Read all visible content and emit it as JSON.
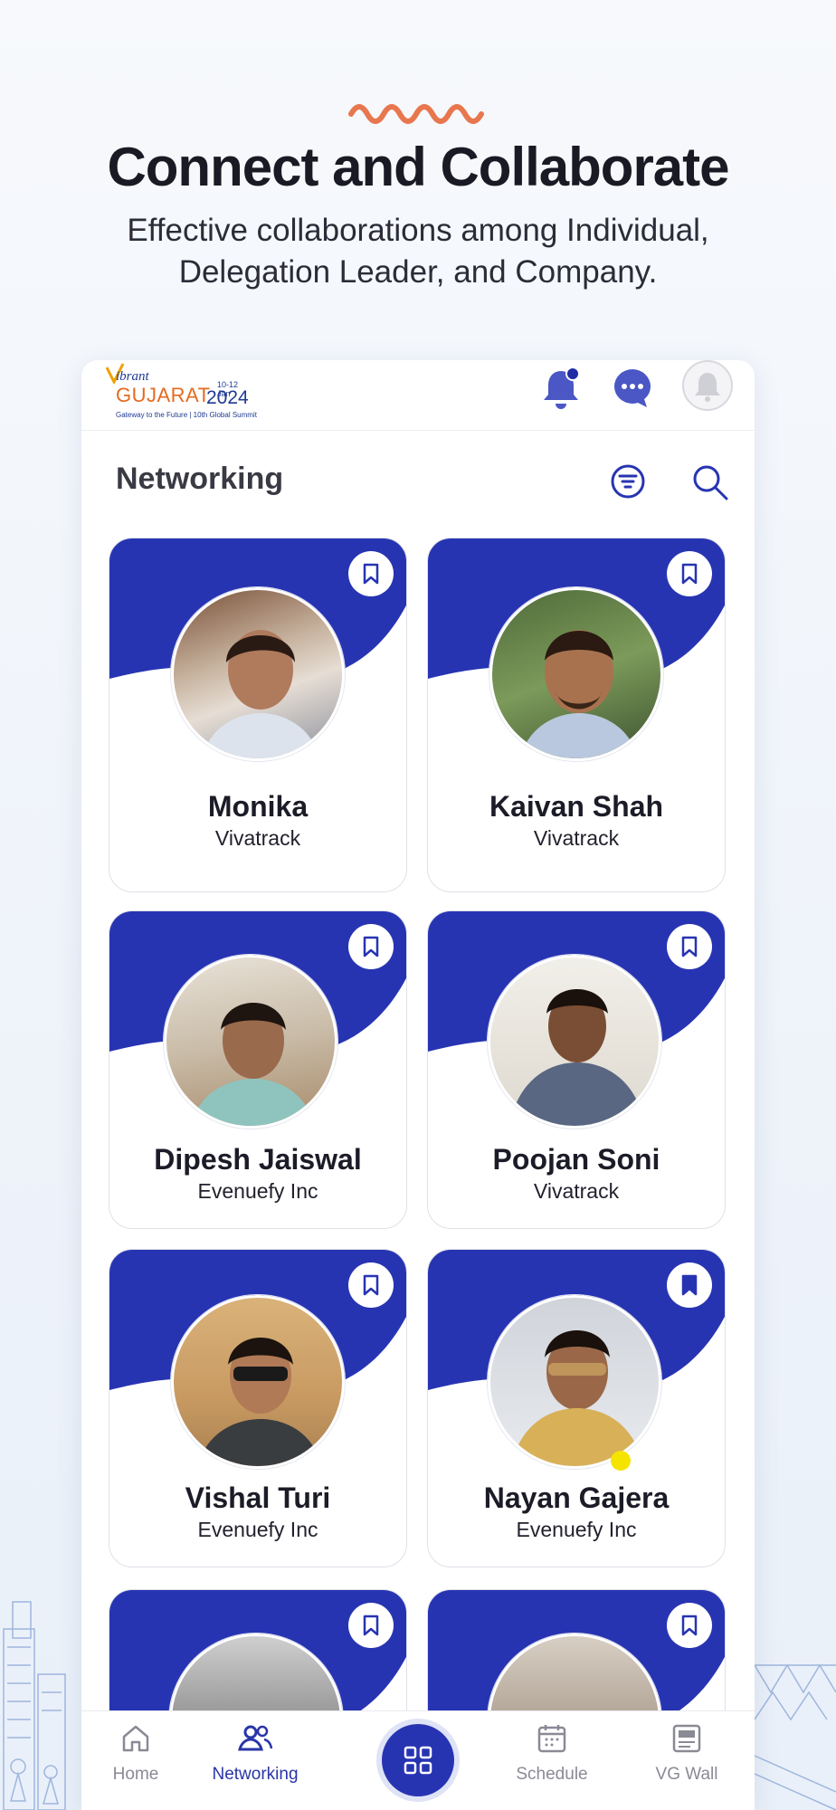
{
  "hero": {
    "title": "Connect and Collaborate",
    "subtitle": "Effective collaborations among Individual, Delegation Leader, and Company."
  },
  "app": {
    "logo": {
      "brand_top": "ibrant",
      "brand_main": "GUJARAT",
      "dates": "10-12 Jan",
      "year": "2024",
      "tagline": "Gateway to the Future | 10th Global Summit"
    },
    "page_title": "Networking"
  },
  "colors": {
    "primary": "#2734B2",
    "accent_orange": "#E8774E",
    "online_dot": "#F5E400"
  },
  "people": [
    {
      "name": "Monika",
      "company": "Vivatrack",
      "bookmarked": false
    },
    {
      "name": "Kaivan Shah",
      "company": "Vivatrack",
      "bookmarked": false
    },
    {
      "name": "Dipesh Jaiswal",
      "company": "Evenuefy Inc",
      "bookmarked": false
    },
    {
      "name": "Poojan Soni",
      "company": "Vivatrack",
      "bookmarked": false
    },
    {
      "name": "Vishal Turi",
      "company": "Evenuefy Inc",
      "bookmarked": false
    },
    {
      "name": "Nayan Gajera",
      "company": "Evenuefy Inc",
      "bookmarked": true
    },
    {
      "name": "",
      "company": "",
      "bookmarked": false
    },
    {
      "name": "",
      "company": "",
      "bookmarked": false
    }
  ],
  "nav": {
    "home": "Home",
    "networking": "Networking",
    "schedule": "Schedule",
    "vgwall": "VG Wall"
  }
}
